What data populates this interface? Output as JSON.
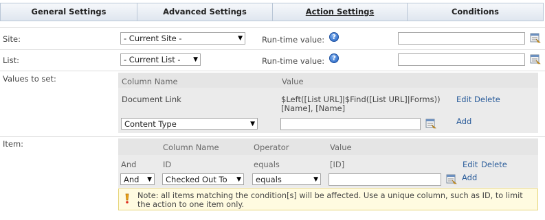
{
  "tabs": [
    {
      "label": "General Settings"
    },
    {
      "label": "Advanced Settings"
    },
    {
      "label": "Action Settings"
    },
    {
      "label": "Conditions"
    }
  ],
  "site": {
    "label": "Site:",
    "select_value": "- Current Site -",
    "runtime_label": "Run-time value:",
    "runtime_value": ""
  },
  "list": {
    "label": "List:",
    "select_value": "- Current List -",
    "runtime_label": "Run-time value:",
    "runtime_value": ""
  },
  "values_to_set": {
    "label": "Values to set:",
    "headers": {
      "column_name": "Column Name",
      "value": "Value"
    },
    "row": {
      "column": "Document Link",
      "value_line1": "$Left([List URL]|$Find([List URL]|Forms))",
      "value_line2": "[Name], [Name]",
      "edit": "Edit",
      "delete": "Delete"
    },
    "new_row": {
      "select_value": "Content Type",
      "value": "",
      "add": "Add"
    }
  },
  "item": {
    "label": "Item:",
    "headers": {
      "column_name": "Column Name",
      "operator": "Operator",
      "value": "Value"
    },
    "row": {
      "logic": "And",
      "column": "ID",
      "operator": "equals",
      "value": "[ID]",
      "edit": "Edit",
      "delete": "Delete"
    },
    "new_row": {
      "logic_select": "And",
      "column_select": "Checked Out To",
      "operator_select": "equals",
      "value": "",
      "add": "Add"
    },
    "note_line1": "Note: all items matching the condition[s] will be affected. Use a unique column, such as ID, to limit",
    "note_line2": "the action to one item only."
  },
  "icons": {
    "help": "help-icon",
    "picker": "lookup-picker-icon",
    "warning": "warning-icon",
    "dropdown": "chevron-down-icon"
  }
}
